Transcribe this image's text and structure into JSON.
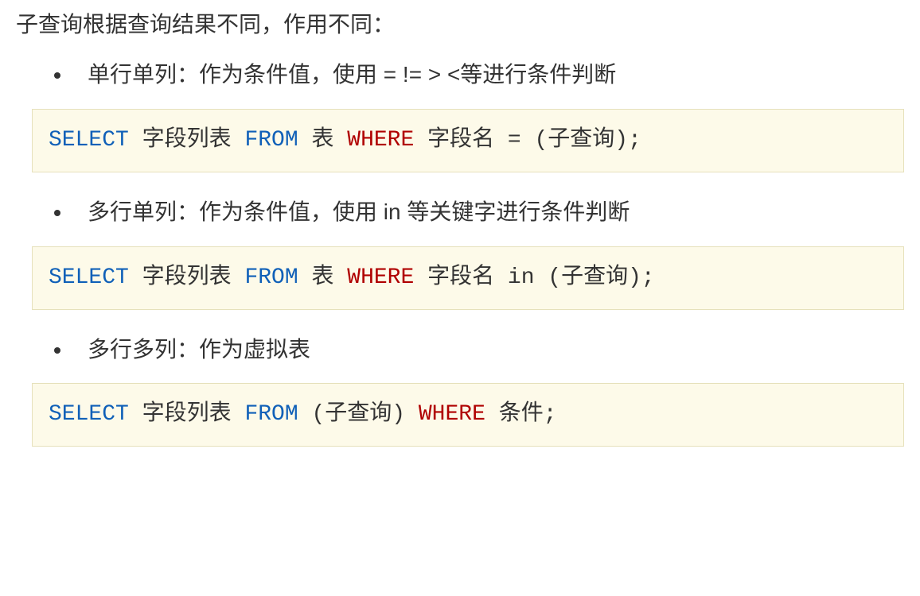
{
  "intro": "子查询根据查询结果不同，作用不同：",
  "sections": [
    {
      "bullet": "单行单列：作为条件值，使用 = != > <等进行条件判断",
      "code": {
        "select": "SELECT",
        "fields": " 字段列表 ",
        "from": "FROM",
        "table": " 表 ",
        "where": "WHERE",
        "rest": " 字段名 = (子查询);"
      }
    },
    {
      "bullet": "多行单列：作为条件值，使用 in 等关键字进行条件判断",
      "code": {
        "select": "SELECT",
        "fields": " 字段列表 ",
        "from": "FROM",
        "table": " 表 ",
        "where": "WHERE",
        "rest": " 字段名 in (子查询);"
      }
    },
    {
      "bullet": "多行多列：作为虚拟表",
      "code": {
        "select": "SELECT",
        "fields": " 字段列表 ",
        "from": "FROM",
        "table": " (子查询) ",
        "where": "WHERE",
        "rest": " 条件;"
      }
    }
  ]
}
